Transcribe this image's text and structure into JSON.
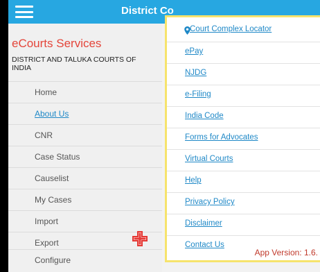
{
  "topbar": {
    "title": "District Co"
  },
  "drawer": {
    "brand": "eCourts Services",
    "subtitle": "DISTRICT AND TALUKA COURTS OF INDIA",
    "items": [
      {
        "label": "Home",
        "active": false
      },
      {
        "label": "About Us",
        "active": true
      },
      {
        "label": "CNR",
        "active": false
      },
      {
        "label": "Case Status",
        "active": false
      },
      {
        "label": "Causelist",
        "active": false
      },
      {
        "label": "My Cases",
        "active": false
      },
      {
        "label": "Import",
        "active": false
      },
      {
        "label": "Export",
        "active": false
      },
      {
        "label": "Configure",
        "active": false
      }
    ]
  },
  "popup": {
    "links": [
      {
        "label": "Court Complex Locator",
        "icon": "location-pin-icon"
      },
      {
        "label": "ePay"
      },
      {
        "label": "NJDG"
      },
      {
        "label": "e-Filing"
      },
      {
        "label": "India Code"
      },
      {
        "label": "Forms for Advocates"
      },
      {
        "label": "Virtual Courts"
      },
      {
        "label": "Help"
      },
      {
        "label": "Privacy Policy"
      },
      {
        "label": "Disclaimer"
      },
      {
        "label": "Contact Us"
      }
    ],
    "version": "App Version: 1.6."
  },
  "colors": {
    "topbar": "#27a7e1",
    "brand": "#e4453a",
    "link": "#1e88c7",
    "highlight_border": "#f6e36c",
    "version_text": "#c0392b",
    "plus_icon": "#e53935"
  }
}
